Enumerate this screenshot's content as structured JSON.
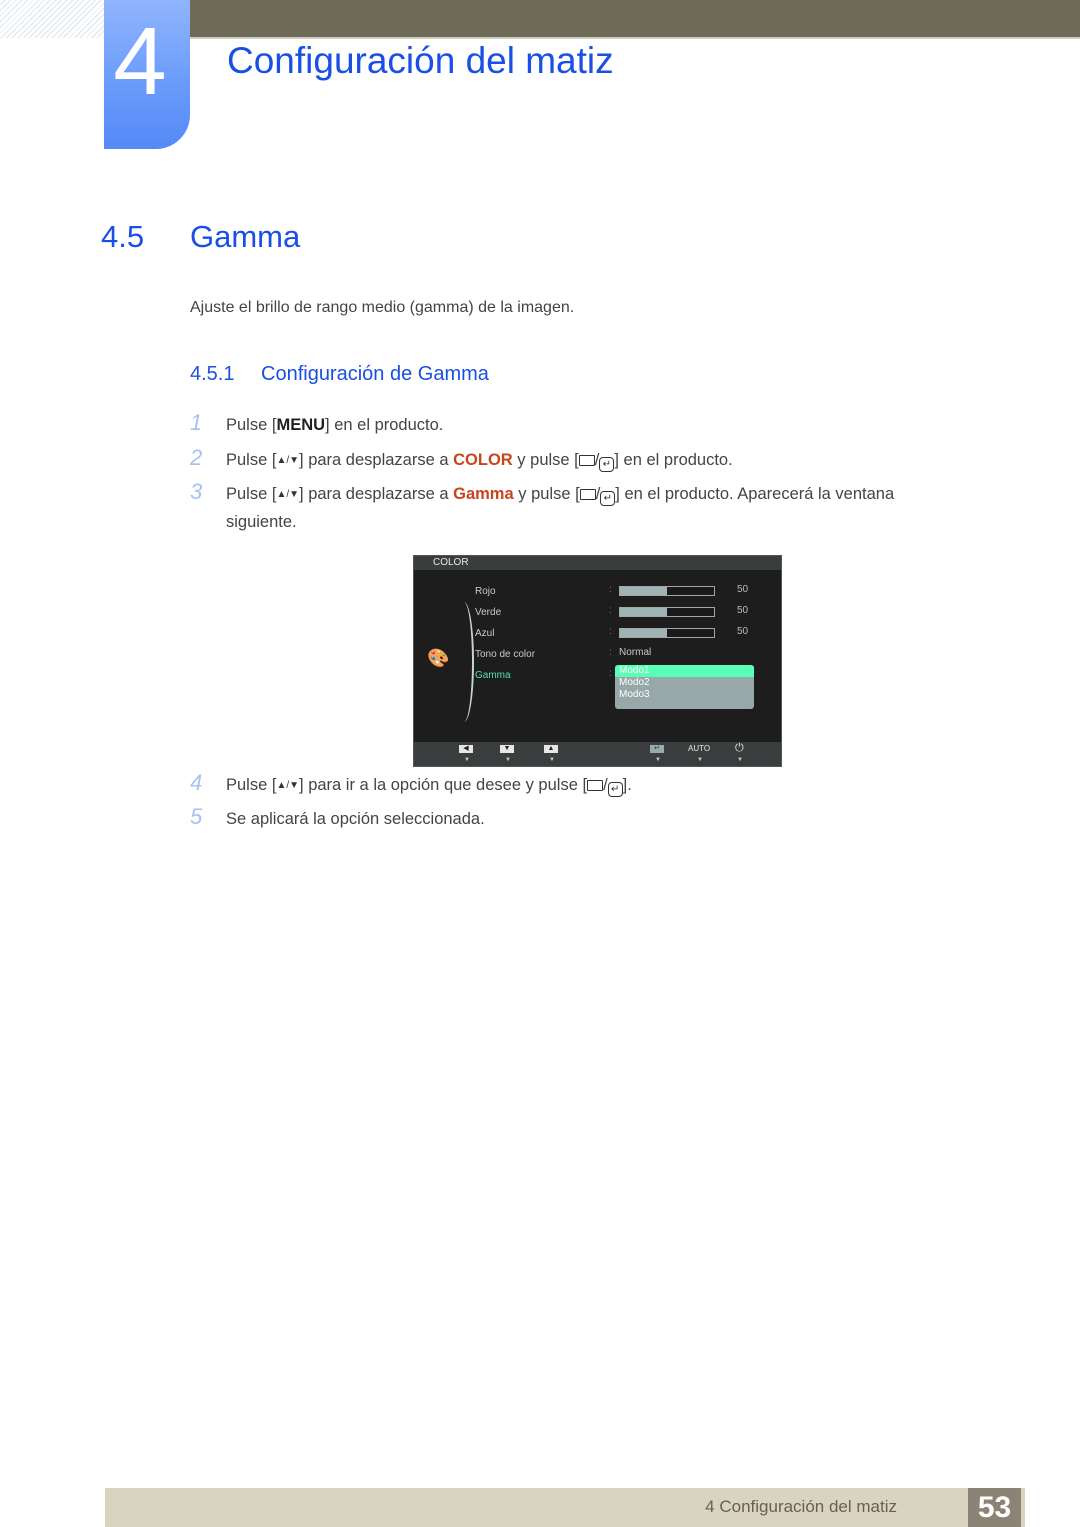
{
  "header": {
    "chapter_number": "4",
    "chapter_title": "Configuración del matiz"
  },
  "section": {
    "number": "4.5",
    "title": "Gamma",
    "intro": "Ajuste el brillo de rango medio (gamma) de la imagen."
  },
  "subsection": {
    "number": "4.5.1",
    "title": "Configuración de Gamma"
  },
  "steps": [
    {
      "n": "1",
      "pre": "Pulse [",
      "key": "MENU",
      "post": "] en el producto."
    },
    {
      "n": "2",
      "pre": "Pulse [",
      "mid": "] para desplazarse a ",
      "kw": "COLOR",
      "mid2": " y pulse [",
      "post": "] en el producto."
    },
    {
      "n": "3",
      "pre": "Pulse [",
      "mid": "] para desplazarse a ",
      "kw": "Gamma",
      "mid2": " y pulse [",
      "post": "] en el producto. Aparecerá la ventana",
      "cont": "siguiente."
    },
    {
      "n": "4",
      "pre": "Pulse [",
      "mid": "] para ir a la opción que desee y pulse [",
      "post": "]."
    },
    {
      "n": "5",
      "text": "Se aplicará la opción seleccionada."
    }
  ],
  "icons": {
    "up_down": "▲/▼",
    "source_enter": "□/↵"
  },
  "osd": {
    "title": "COLOR",
    "items": [
      {
        "label": "Rojo",
        "value": "50",
        "level": 0.5
      },
      {
        "label": "Verde",
        "value": "50",
        "level": 0.5
      },
      {
        "label": "Azul",
        "value": "50",
        "level": 0.5
      },
      {
        "label": "Tono de color",
        "value": "Normal"
      },
      {
        "label": "Gamma",
        "active": true
      }
    ],
    "gamma_options": [
      "Modo1",
      "Modo2",
      "Modo3"
    ],
    "gamma_selected": "Modo1",
    "footer": {
      "auto_label": "AUTO"
    }
  },
  "footer": {
    "label": "4 Configuración del matiz",
    "page": "53"
  },
  "colors": {
    "heading_blue": "#1a4fe6",
    "keyword_orange": "#c8451d",
    "osd_active": "#4fe0a8"
  }
}
